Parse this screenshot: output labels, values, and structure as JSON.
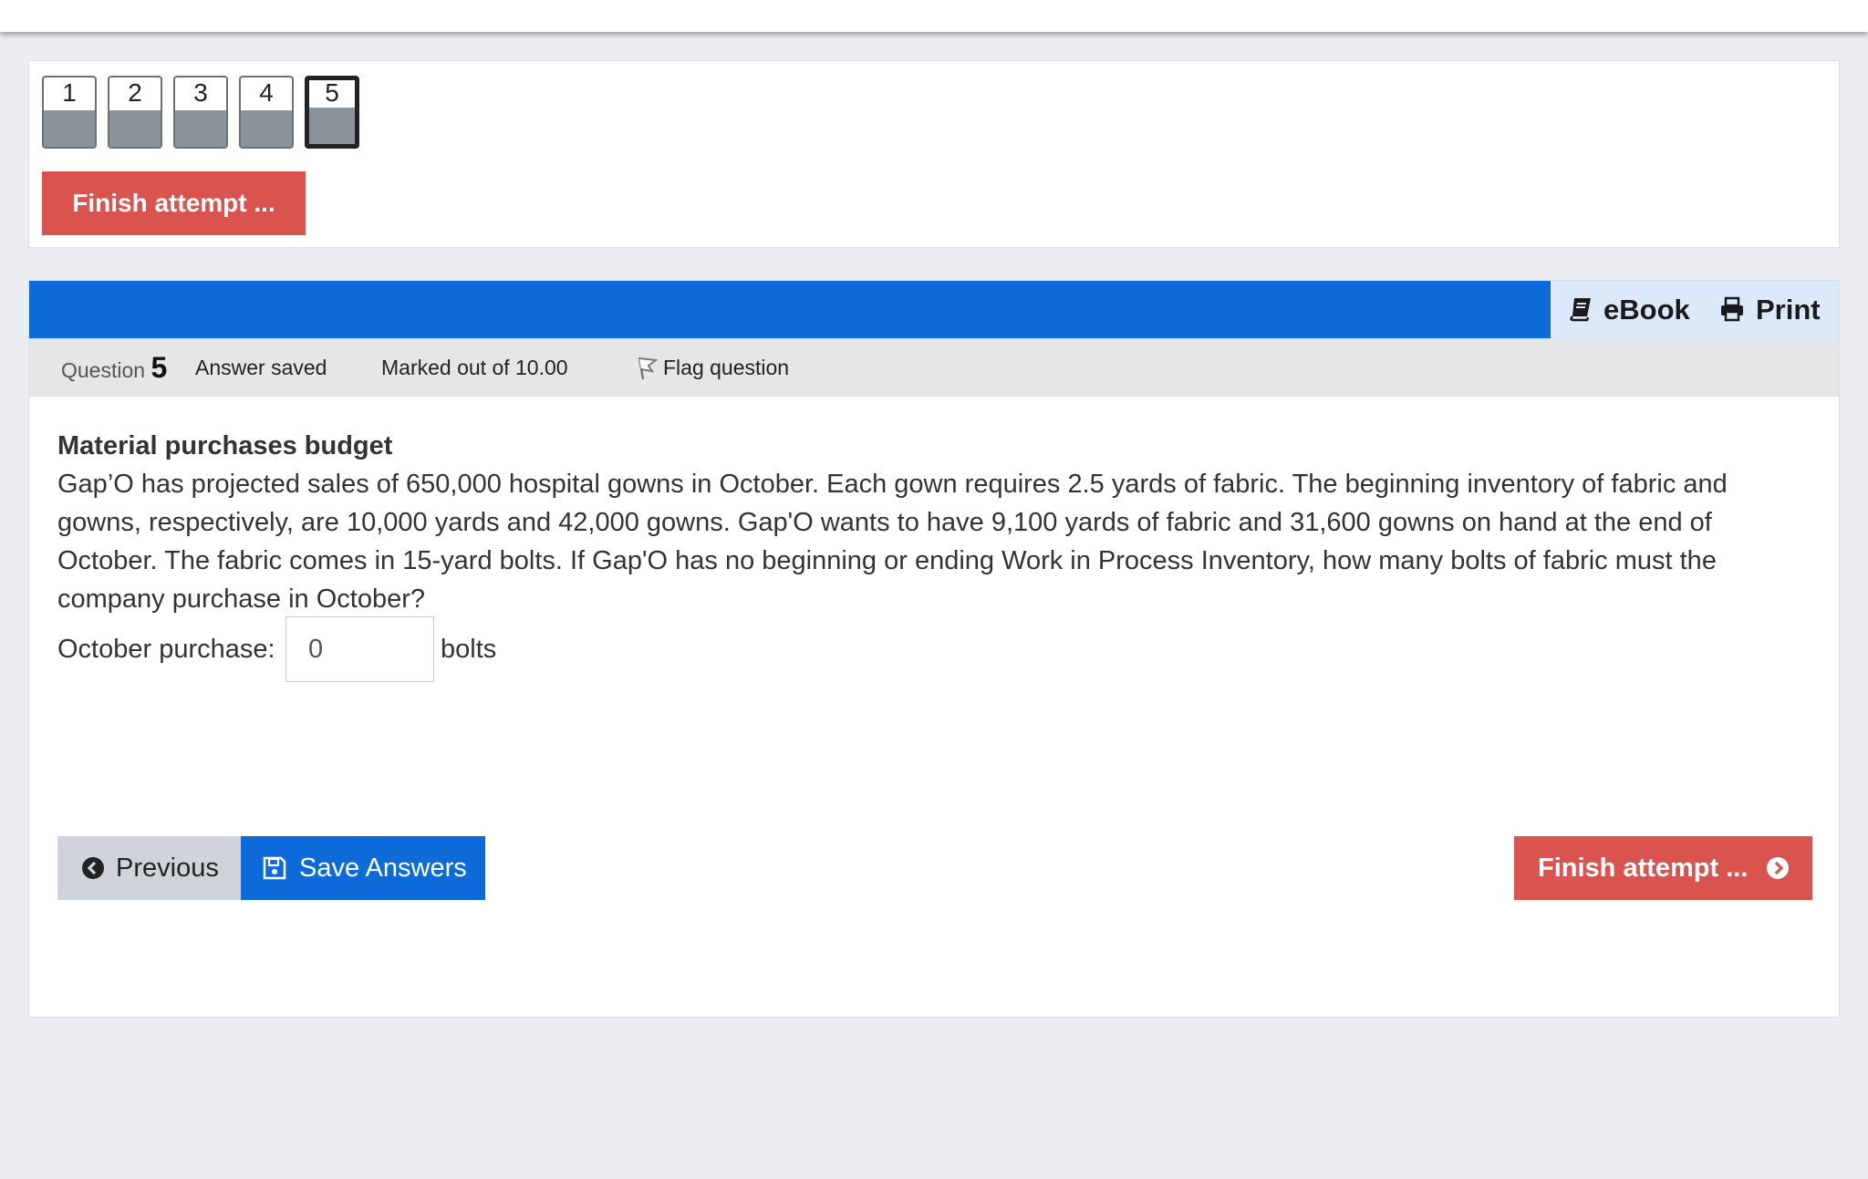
{
  "nav": {
    "questions": [
      {
        "number": "1"
      },
      {
        "number": "2"
      },
      {
        "number": "3"
      },
      {
        "number": "4"
      },
      {
        "number": "5",
        "current": true
      }
    ],
    "finish_label": "Finish attempt ..."
  },
  "toolbar": {
    "ebook_label": "eBook",
    "print_label": "Print"
  },
  "info": {
    "question_label": "Question",
    "question_number": "5",
    "state": "Answer saved",
    "marks": "Marked out of 10.00",
    "flag_label": "Flag question"
  },
  "question": {
    "title": "Material purchases budget",
    "text": "Gap’O has projected sales of 650,000 hospital gowns in October. Each gown requires 2.5 yards of fabric. The beginning inventory of fabric and gowns, respectively, are 10,000 yards and 42,000 gowns. Gap'O wants to have 9,100 yards of fabric and 31,600 gowns on hand at the end of October. The fabric comes in 15-yard bolts. If Gap'O has no beginning or ending Work in Process Inventory, how many bolts of fabric must the company purchase in October?",
    "answer_label": "October purchase:",
    "answer_value": "0",
    "answer_unit": "bolts"
  },
  "buttons": {
    "previous": "Previous",
    "save": "Save Answers",
    "finish": "Finish attempt ..."
  },
  "colors": {
    "primary_blue": "#0c6bd9",
    "danger_red": "#d9534f",
    "page_bg": "#eceef1"
  }
}
